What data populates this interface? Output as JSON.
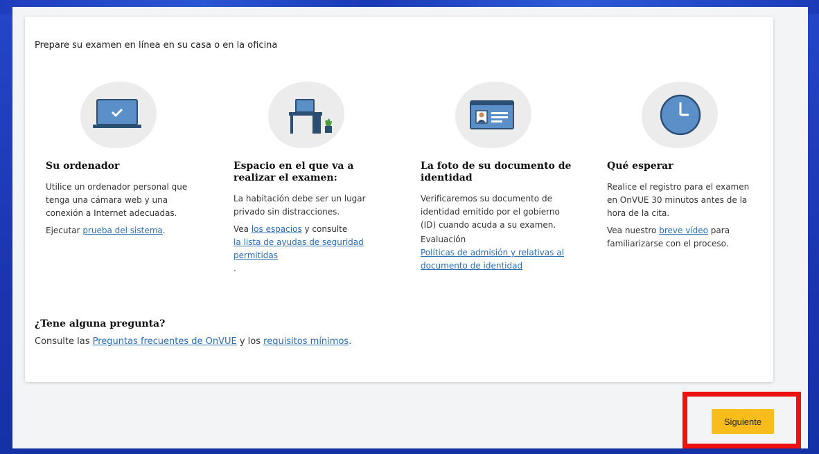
{
  "intro": "Prepare su examen en línea en su casa o en la oficina",
  "columns": [
    {
      "icon": "laptop-icon",
      "title": "Su ordenador",
      "body": "Utilice un ordenador personal que tenga una cámara web y una conexión a Internet adecuadas.",
      "action_prefix": "Ejecutar ",
      "action_link": "prueba del sistema",
      "action_suffix": "."
    },
    {
      "icon": "desk-icon",
      "title": "Espacio en el que va a realizar el examen:",
      "body": "La habitación debe ser un lugar privado sin distracciones.",
      "action_prefix": "Vea ",
      "action_link": "los espacios",
      "action_middle": " y consulte ",
      "action_link2": "la lista de ayudas de seguridad permitidas",
      "action_suffix": "."
    },
    {
      "icon": "id-card-icon",
      "title": "La foto de su documento de identidad",
      "body": "Verificaremos su documento de identidad emitido por el gobierno (ID) cuando acuda a su examen.",
      "label": "Evaluación",
      "action_link": "Políticas de admisión y relativas al documento de identidad"
    },
    {
      "icon": "clock-icon",
      "title": "Qué esperar",
      "body": "Realice el registro para el examen en OnVUE 30 minutos antes de la hora de la cita.",
      "action_prefix": "Vea nuestro ",
      "action_link": "breve vídeo",
      "action_suffix": " para familiarizarse con el proceso."
    }
  ],
  "question": {
    "title": "¿Tene alguna pregunta?",
    "prefix": "Consulte las ",
    "link1": "Preguntas frecuentes de OnVUE",
    "middle": " y los ",
    "link2": "requisitos mínimos",
    "suffix": "."
  },
  "next_button": "Siguiente",
  "colors": {
    "accent_button": "#f8bd1c",
    "link": "#2a6db5",
    "icon_blue": "#5b8fc7",
    "highlight": "#ee1111"
  }
}
